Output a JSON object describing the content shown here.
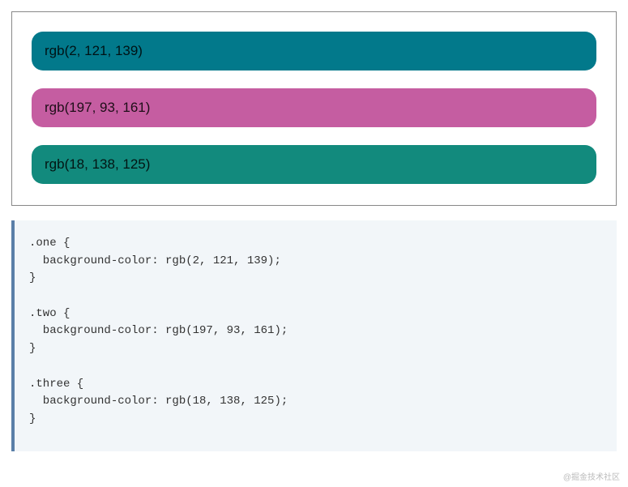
{
  "demo": {
    "boxes": [
      {
        "label": "rgb(2, 121, 139)",
        "color": "rgb(2, 121, 139)",
        "class": "one"
      },
      {
        "label": "rgb(197, 93, 161)",
        "color": "rgb(197, 93, 161)",
        "class": "two"
      },
      {
        "label": "rgb(18, 138, 125)",
        "color": "rgb(18, 138, 125)",
        "class": "three"
      }
    ]
  },
  "code": ".one {\n  background-color: rgb(2, 121, 139);\n}\n\n.two {\n  background-color: rgb(197, 93, 161);\n}\n\n.three {\n  background-color: rgb(18, 138, 125);\n}",
  "watermark": "@掘金技术社区"
}
